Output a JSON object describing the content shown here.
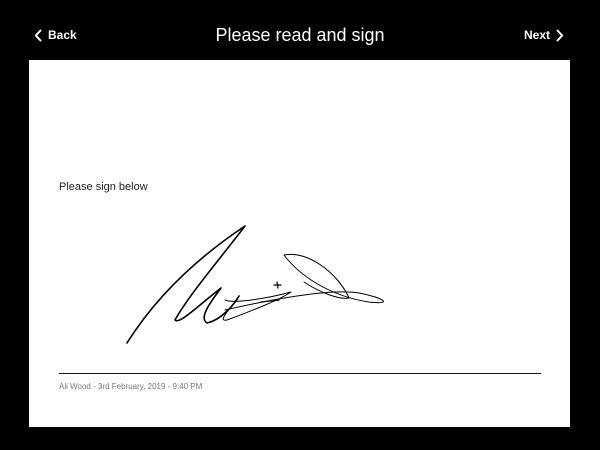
{
  "header": {
    "back_label": "Back",
    "title": "Please read and sign",
    "next_label": "Next"
  },
  "icons": {
    "back": "chevron-left-icon",
    "next": "chevron-right-icon"
  },
  "signature_pad": {
    "instruction": "Please sign below",
    "signer_meta": "Ali Wood - 3rd February, 2019 - 9:40 PM"
  },
  "colors": {
    "background": "#000000",
    "card": "#ffffff",
    "ink": "#000000"
  }
}
